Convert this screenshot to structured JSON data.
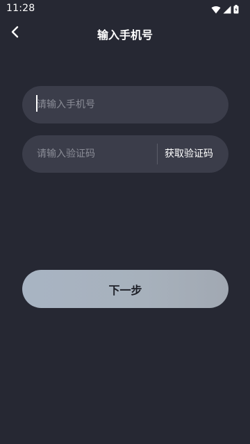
{
  "status_bar": {
    "time": "11:28",
    "icons": [
      "wifi-icon",
      "signal-icon",
      "battery-icon"
    ]
  },
  "header": {
    "back_icon": "chevron-left-icon",
    "title": "输入手机号"
  },
  "form": {
    "phone": {
      "value": "",
      "placeholder": "请输入手机号"
    },
    "code": {
      "value": "",
      "placeholder": "请输入验证码",
      "get_code_label": "获取验证码"
    },
    "next_label": "下一步"
  },
  "colors": {
    "background": "#262833",
    "field_background": "#3b3d4a",
    "button_background": "#a8b4c3",
    "text_primary": "#ffffff",
    "placeholder": "#8a8c96"
  }
}
